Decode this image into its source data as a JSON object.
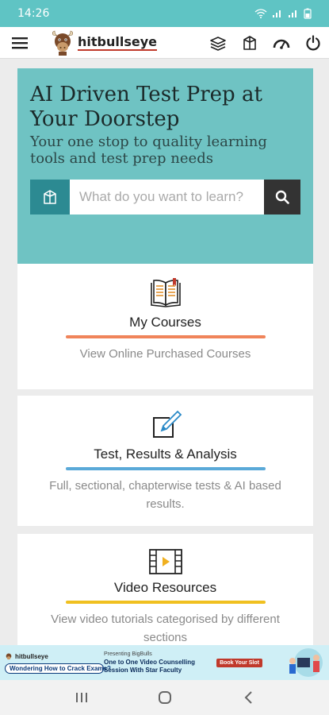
{
  "status_bar": {
    "time": "14:26",
    "icons": [
      "wifi-icon",
      "signal-icon",
      "signal-icon",
      "battery-icon"
    ]
  },
  "header": {
    "logo_text": "hitbullseye",
    "actions": [
      "courses-icon",
      "catalog-icon",
      "dashboard-icon",
      "power-icon"
    ]
  },
  "hero": {
    "title": "AI Driven Test Prep at Your Doorstep",
    "subtitle": "Your one stop to quality learning tools and test prep needs",
    "search": {
      "placeholder": "What do you want to learn?"
    }
  },
  "cards": [
    {
      "title": "My Courses",
      "description": "View Online Purchased Courses",
      "icon": "book-icon",
      "accent": "#f0845a"
    },
    {
      "title": "Test, Results & Analysis",
      "description": "Full, sectional, chapterwise tests & AI based results.",
      "icon": "edit-icon",
      "accent": "#5aa9d8"
    },
    {
      "title": "Video Resources",
      "description": "View video tutorials categorised by different sections",
      "icon": "film-icon",
      "accent": "#f0c020"
    }
  ],
  "ad": {
    "brand": "hitbullseye",
    "pill": "Wondering How to Crack Exams?",
    "presenting": "Presenting BigBulls",
    "line1": "One to One Video Counselling",
    "line2": "Session With Star Faculty",
    "cta": "Book Your Slot"
  },
  "colors": {
    "teal": "#5fc4c4",
    "hero_bg": "#6fc3c3",
    "dark_button": "#333333",
    "catalog_button": "#2c8a92"
  }
}
